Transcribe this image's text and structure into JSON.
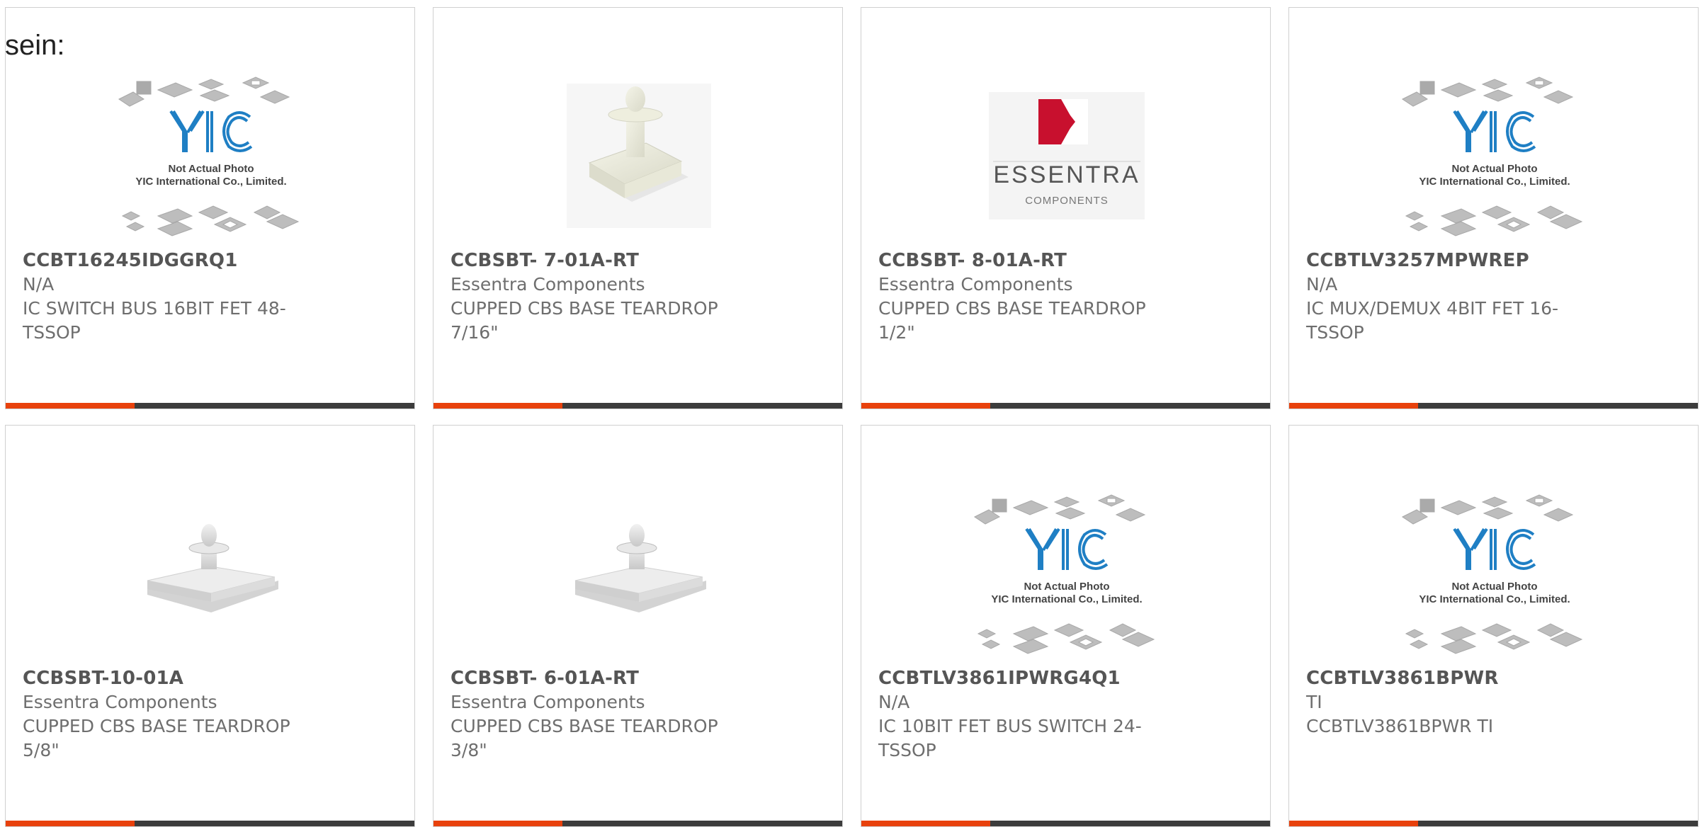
{
  "intro": {
    "text": "sein:"
  },
  "colors": {
    "accent": "#e8410c",
    "bar": "#3c3c3c",
    "text": "#6e6e6e",
    "title": "#555555",
    "yic_blue": "#1f7fc4",
    "essentra_red": "#c8102e"
  },
  "placeholder_image": {
    "line1": "Not Actual Photo",
    "line2": "YIC International Co., Limited.",
    "logo": "YIC"
  },
  "essentra_logo": {
    "name": "ESSENTRA",
    "sub": "COMPONENTS"
  },
  "products": [
    {
      "part_number": "CCBT16245IDGGRQ1",
      "manufacturer": "N/A",
      "description": "IC SWITCH BUS 16BIT FET 48-TSSOP",
      "image": "yic-placeholder"
    },
    {
      "part_number": "CCBSBT- 7-01A-RT",
      "manufacturer": "Essentra Components",
      "description": "CUPPED CBS BASE TEARDROP 7/16\"",
      "image": "standoff-tall"
    },
    {
      "part_number": "CCBSBT- 8-01A-RT",
      "manufacturer": "Essentra Components",
      "description": "CUPPED CBS BASE TEARDROP 1/2\"",
      "image": "essentra-logo"
    },
    {
      "part_number": "CCBTLV3257MPWREP",
      "manufacturer": "N/A",
      "description": "IC MUX/DEMUX 4BIT FET 16-TSSOP",
      "image": "yic-placeholder"
    },
    {
      "part_number": "CCBSBT-10-01A",
      "manufacturer": "Essentra Components",
      "description": "CUPPED CBS BASE TEARDROP 5/8\"",
      "image": "standoff-flat"
    },
    {
      "part_number": "CCBSBT- 6-01A-RT",
      "manufacturer": "Essentra Components",
      "description": "CUPPED CBS BASE TEARDROP 3/8\"",
      "image": "standoff-flat"
    },
    {
      "part_number": "CCBTLV3861IPWRG4Q1",
      "manufacturer": "N/A",
      "description": "IC 10BIT FET BUS SWITCH 24-TSSOP",
      "image": "yic-placeholder"
    },
    {
      "part_number": "CCBTLV3861BPWR",
      "manufacturer": "TI",
      "description": "CCBTLV3861BPWR TI",
      "image": "yic-placeholder"
    }
  ]
}
